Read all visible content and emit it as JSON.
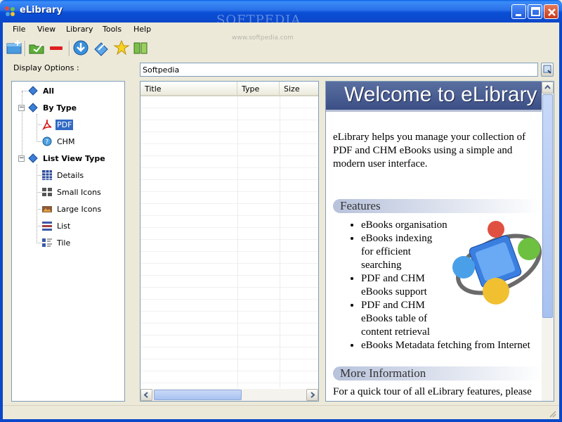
{
  "window": {
    "title": "eLibrary",
    "watermark": "SOFTPEDIA",
    "watermark_url": "www.softpedia.com"
  },
  "menu": [
    "File",
    "View",
    "Library",
    "Tools",
    "Help"
  ],
  "display_options_label": "Display Options :",
  "search": {
    "value": "Softpedia"
  },
  "tree": {
    "all": "All",
    "by_type": "By Type",
    "pdf": "PDF",
    "chm": "CHM",
    "list_view_type": "List View Type",
    "details": "Details",
    "small_icons": "Small Icons",
    "large_icons": "Large Icons",
    "list": "List",
    "tile": "Tile"
  },
  "list_columns": [
    "Title",
    "Type",
    "Size"
  ],
  "welcome": {
    "banner": "Welcome to eLibrary",
    "intro": "eLibrary helps you manage your collection of PDF and CHM eBooks using a simple and modern user interface.",
    "features_header": "Features",
    "features": [
      "eBooks organisation",
      "eBooks indexing for efficient searching",
      "PDF and CHM eBooks support",
      "PDF and CHM eBooks table of content retrieval",
      "eBooks Metadata fetching from Internet"
    ],
    "more_header": "More Information",
    "more_text": "For a quick tour of all eLibrary features, please"
  },
  "colors": {
    "title_bar": "#0a4fd6",
    "selection": "#316ac5",
    "banner": "#4a5e94"
  }
}
